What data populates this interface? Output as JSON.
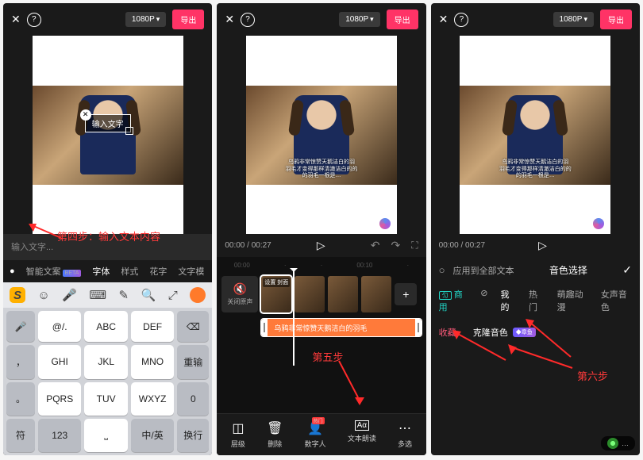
{
  "top": {
    "res": "1080P",
    "export": "导出"
  },
  "p1": {
    "caption_placeholder": "输入文字",
    "input_placeholder": "输入文字...",
    "annotation": "第四步：输入文本内容",
    "sec": [
      "智能文案",
      "字体",
      "样式",
      "花字",
      "文字模"
    ],
    "beta": "BETA",
    "keys": {
      "r1": [
        "@/.",
        "ABC",
        "DEF"
      ],
      "r2": [
        "GHI",
        "JKL",
        "MNO"
      ],
      "r3": [
        "PQRS",
        "TUV",
        "WXYZ"
      ],
      "side": [
        "重输",
        "换行"
      ],
      "left": [
        "符",
        "123"
      ],
      "bottom_mid": "中/英"
    }
  },
  "p2": {
    "time_cur": "00:00",
    "time_dur": "00:27",
    "ruler": [
      "00:00",
      "00:10"
    ],
    "mute": "关闭原声",
    "clip_label": "设置\n封面",
    "txt_track": "乌鸦非常惊赞天鹅洁白的羽毛",
    "annotation": "第五步",
    "tools": [
      {
        "icon": "◫",
        "label": "层级"
      },
      {
        "icon": "🗑",
        "label": "删除"
      },
      {
        "icon": "👤",
        "label": "数字人",
        "badge": "热门"
      },
      {
        "icon": "Aα",
        "label": "文本朗读"
      },
      {
        "icon": "⋯",
        "label": "多选"
      }
    ]
  },
  "p3": {
    "time_cur": "00:00",
    "time_dur": "00:27",
    "apply": "应用到全部文本",
    "title": "音色选择",
    "tabs": [
      "商用",
      "我的",
      "热门",
      "萌趣动漫",
      "女声音色"
    ],
    "tab_badge": "匀",
    "fav": "收藏",
    "voice": "克隆音色",
    "vip": "◆章鱼",
    "annotation": "第六步",
    "sub1": "乌鸦非常惊赞天鹅洁白的羽",
    "sub2": "羽毛才变得那样清澈洁白的的",
    "sub3": "的羽毛一根是…"
  }
}
